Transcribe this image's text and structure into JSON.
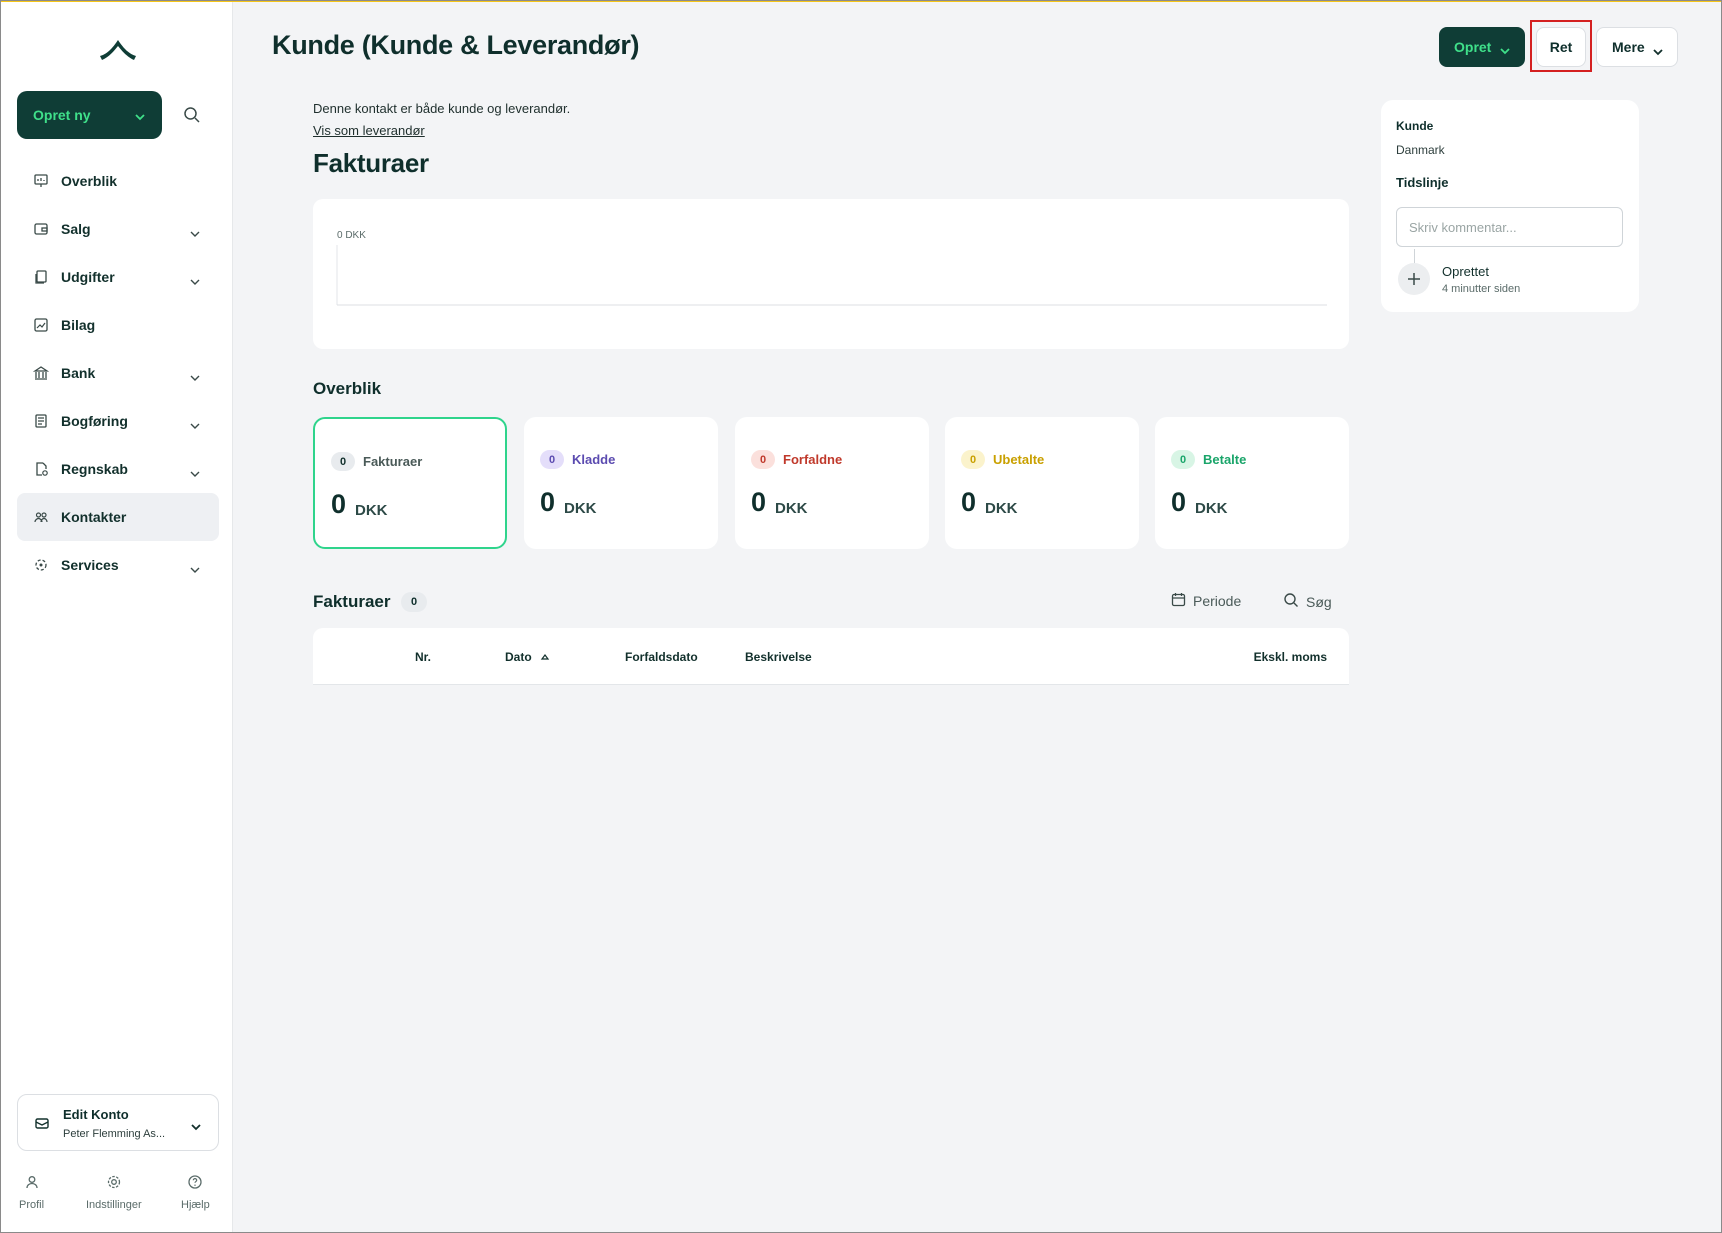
{
  "sidebar": {
    "create_new_label": "Opret ny",
    "items": [
      {
        "label": "Overblik",
        "icon": "dashboard-icon",
        "has_chevron": false,
        "active": false
      },
      {
        "label": "Salg",
        "icon": "wallet-icon",
        "has_chevron": true,
        "active": false
      },
      {
        "label": "Udgifter",
        "icon": "documents-icon",
        "has_chevron": true,
        "active": false
      },
      {
        "label": "Bilag",
        "icon": "image-receipt-icon",
        "has_chevron": false,
        "active": false
      },
      {
        "label": "Bank",
        "icon": "bank-icon",
        "has_chevron": true,
        "active": false
      },
      {
        "label": "Bogføring",
        "icon": "ledger-icon",
        "has_chevron": true,
        "active": false
      },
      {
        "label": "Regnskab",
        "icon": "report-icon",
        "has_chevron": true,
        "active": false
      },
      {
        "label": "Kontakter",
        "icon": "contacts-icon",
        "has_chevron": false,
        "active": true
      },
      {
        "label": "Services",
        "icon": "services-icon",
        "has_chevron": true,
        "active": false
      }
    ],
    "account": {
      "name": "Edit Konto",
      "sub": "Peter Flemming As..."
    },
    "bottom": {
      "profile": "Profil",
      "settings": "Indstillinger",
      "help": "Hjælp"
    }
  },
  "header": {
    "title": "Kunde (Kunde & Leverandør)",
    "create_label": "Opret",
    "edit_label": "Ret",
    "more_label": "Mere"
  },
  "main": {
    "info_text": "Denne kontakt er både kunde og leverandør.",
    "info_link": "Vis som leverandør",
    "section_title": "Fakturaer",
    "overview_title": "Overblik",
    "stats": [
      {
        "label": "Fakturaer",
        "count": "0",
        "amount": "0",
        "currency": "DKK",
        "color": "#4a5a58",
        "badge_bg": "#e8ebee"
      },
      {
        "label": "Kladde",
        "count": "0",
        "amount": "0",
        "currency": "DKK",
        "color": "#5b4bb0",
        "badge_bg": "#e4defa"
      },
      {
        "label": "Forfaldne",
        "count": "0",
        "amount": "0",
        "currency": "DKK",
        "color": "#c0392b",
        "badge_bg": "#fbe0dc"
      },
      {
        "label": "Ubetalte",
        "count": "0",
        "amount": "0",
        "currency": "DKK",
        "color": "#c9a000",
        "badge_bg": "#fbf3cc"
      },
      {
        "label": "Betalte",
        "count": "0",
        "amount": "0",
        "currency": "DKK",
        "color": "#1aa56a",
        "badge_bg": "#d8f5e5"
      }
    ],
    "invoices": {
      "title": "Fakturaer",
      "count": "0",
      "periode_label": "Periode",
      "search_label": "Søg",
      "columns": {
        "nr": "Nr.",
        "dato": "Dato",
        "forfald": "Forfaldsdato",
        "beskrivelse": "Beskrivelse",
        "ekskl": "Ekskl. moms"
      }
    }
  },
  "chart_data": {
    "type": "bar",
    "categories": [],
    "values": [],
    "ylabel": "",
    "xlabel": "",
    "y_tick_label": "0 DKK",
    "ylim": [
      0,
      0
    ]
  },
  "right_panel": {
    "type_label": "Kunde",
    "country": "Danmark",
    "timeline_title": "Tidslinje",
    "comment_placeholder": "Skriv kommentar...",
    "event_title": "Oprettet",
    "event_time": "4 minutter siden"
  },
  "colors": {
    "brand_dark": "#0f3d36",
    "brand_green": "#3fe08a",
    "accent_border": "#2fd48c",
    "highlight_red": "#d42020"
  }
}
